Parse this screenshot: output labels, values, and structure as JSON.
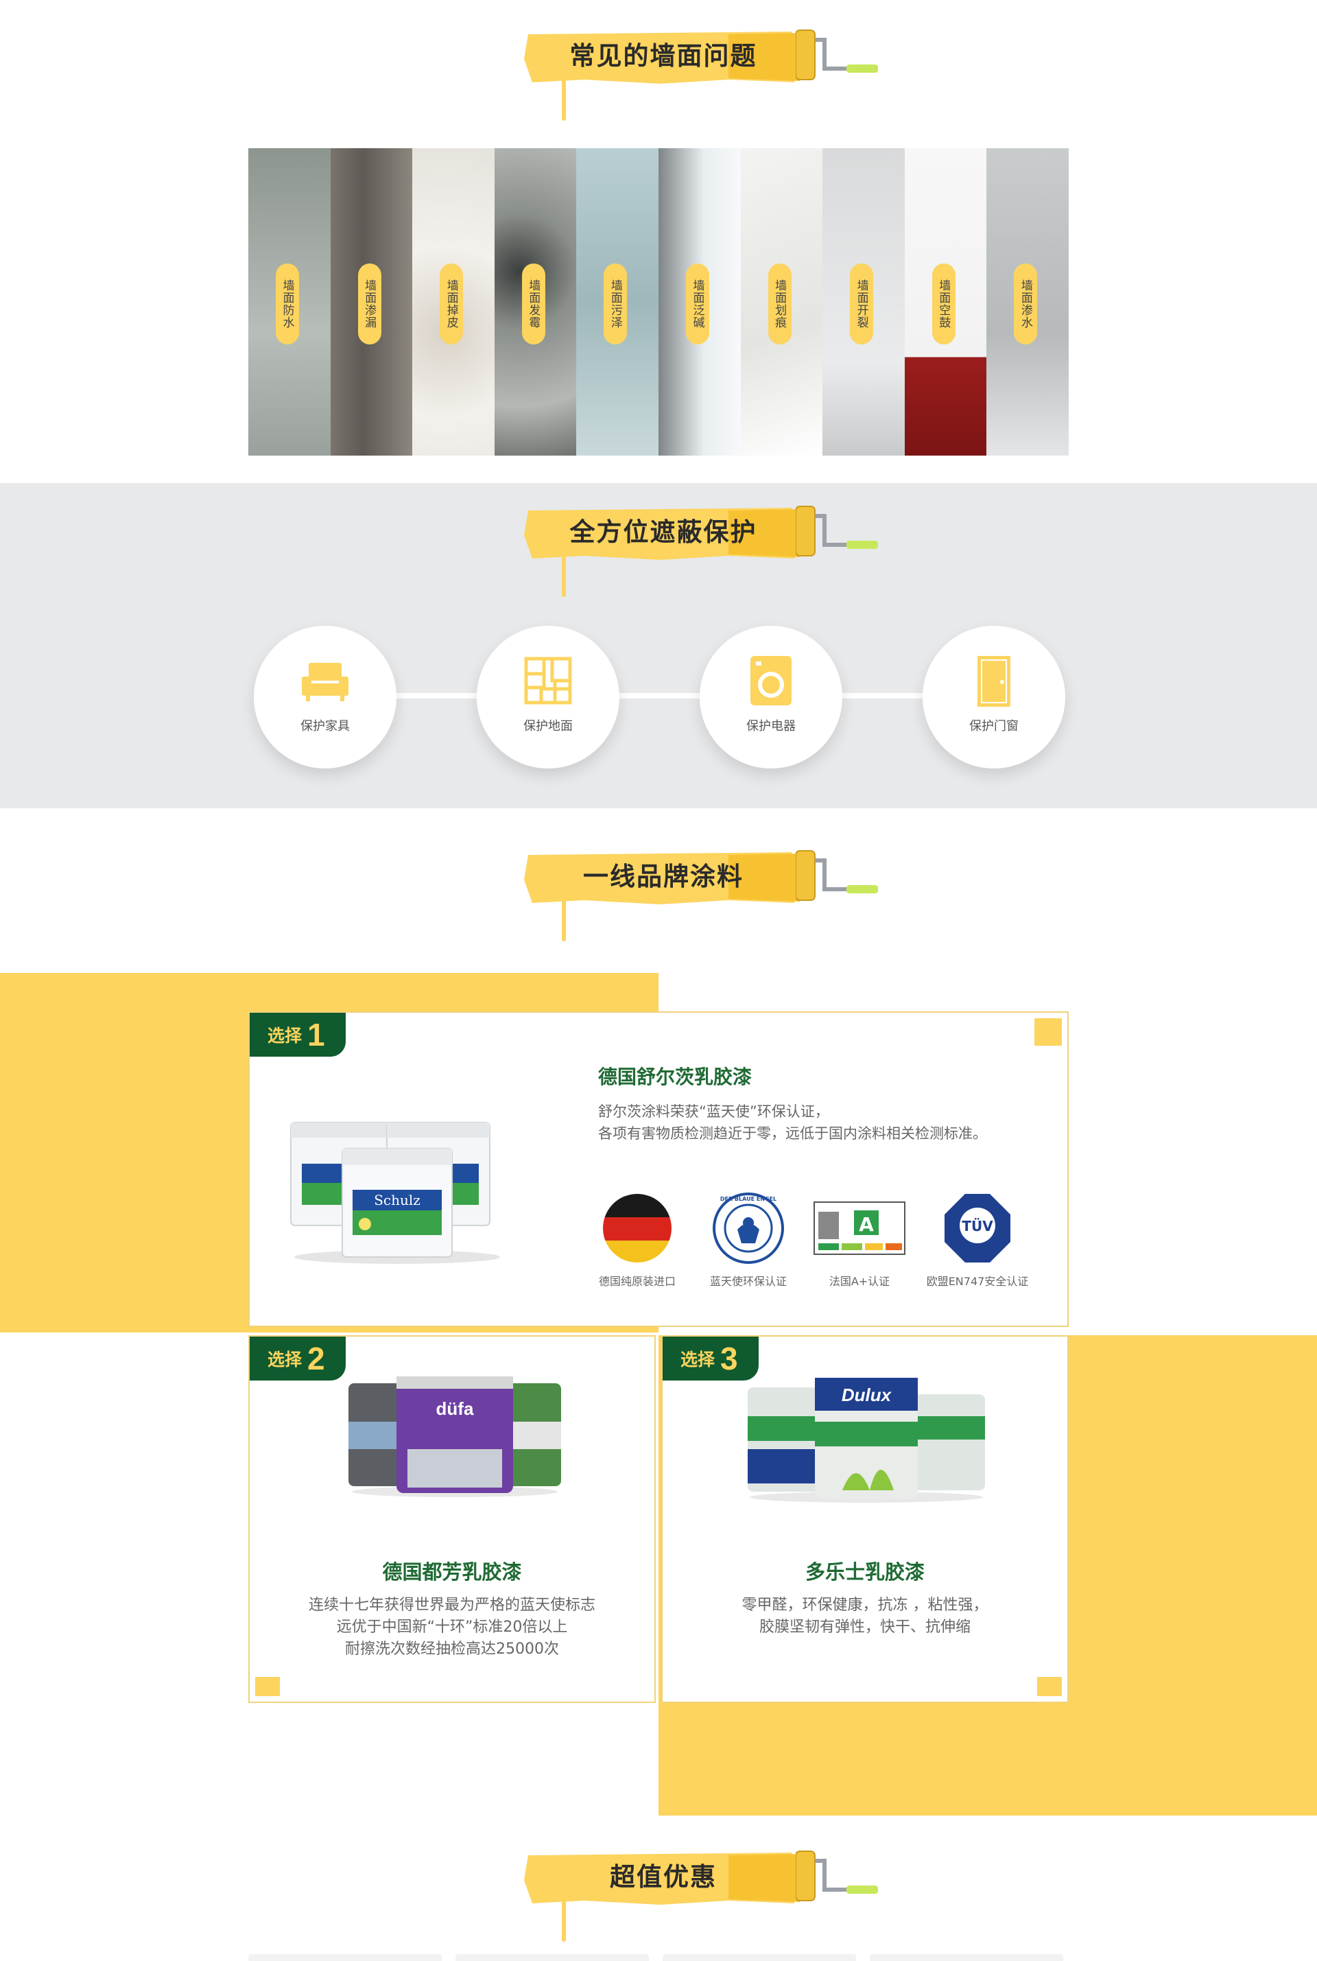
{
  "colors": {
    "accent_yellow": "#fcd45e",
    "brand_green": "#1f6a34",
    "tag_green": "#0f5a2e",
    "panel_gray": "#e8e9eb"
  },
  "section_problems": {
    "title": "常见的墙面问题",
    "items": [
      {
        "label": "墙面防水"
      },
      {
        "label": "墙面渗漏"
      },
      {
        "label": "墙面掉皮"
      },
      {
        "label": "墙面发霉"
      },
      {
        "label": "墙面污泽"
      },
      {
        "label": "墙面泛碱"
      },
      {
        "label": "墙面划痕"
      },
      {
        "label": "墙面开裂"
      },
      {
        "label": "墙面空鼓"
      },
      {
        "label": "墙面渗水"
      }
    ]
  },
  "section_protect": {
    "title": "全方位遮蔽保护",
    "items": [
      {
        "label": "保护家具",
        "icon": "sofa-icon"
      },
      {
        "label": "保护地面",
        "icon": "floor-icon"
      },
      {
        "label": "保护电器",
        "icon": "washing-machine-icon"
      },
      {
        "label": "保护门窗",
        "icon": "door-icon"
      }
    ]
  },
  "section_brands": {
    "title": "一线品牌涂料",
    "choice1": {
      "tag_text": "选择",
      "tag_num": "1",
      "title": "德国舒尔茨乳胶漆",
      "desc_line1": "舒尔茨涂料荣获“蓝天使”环保认证，",
      "desc_line2": "各项有害物质检测趋近于零，远低于国内涂料相关检测标准。",
      "product_label": "Schulz",
      "certs": [
        {
          "label": "德国纯原装进口",
          "icon": "germany-flag-icon"
        },
        {
          "label": "蓝天使环保认证",
          "icon": "blue-angel-icon",
          "badge_text": "DER BLAUE ENGEL"
        },
        {
          "label": "法国A+认证",
          "icon": "a-plus-icon",
          "badge_text": "A"
        },
        {
          "label": "欧盟EN747安全认证",
          "icon": "tuv-icon",
          "badge_text": "TÜV"
        }
      ]
    },
    "choice2": {
      "tag_text": "选择",
      "tag_num": "2",
      "title": "德国都芳乳胶漆",
      "desc_line1": "连续十七年获得世界最为严格的蓝天使标志",
      "desc_line2": "远优于中国新“十环”标准20倍以上",
      "desc_line3": "耐擦洗次数经抽检高达25000次",
      "product_label": "düfa"
    },
    "choice3": {
      "tag_text": "选择",
      "tag_num": "3",
      "title": "多乐士乳胶漆",
      "desc_line1": "零甲醛，环保健康，抗冻 ，粘性强，",
      "desc_line2": "胶膜坚韧有弹性，快干、抗伸缩",
      "product_label": "Dulux"
    }
  },
  "section_value": {
    "title": "超值优惠"
  }
}
